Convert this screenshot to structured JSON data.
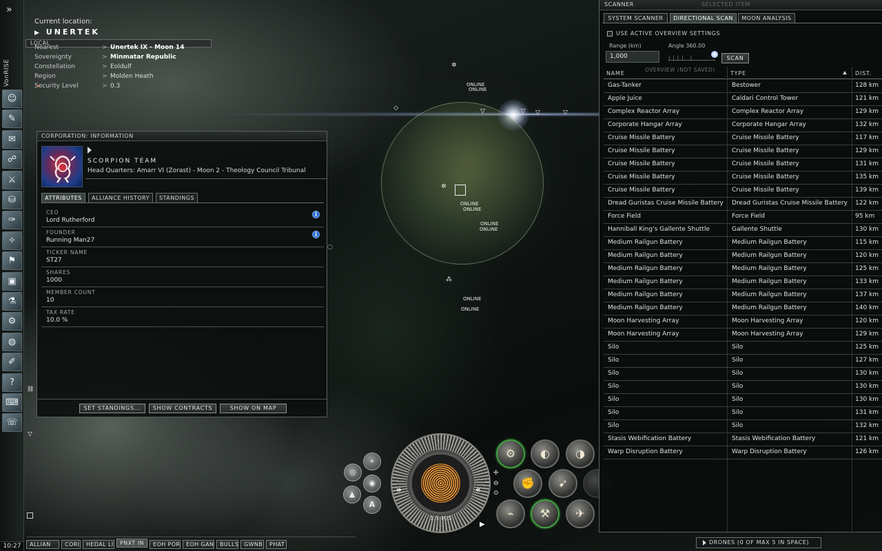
{
  "neocom": {
    "username": "VonRISE",
    "clock": "10:27",
    "buttons": [
      "character-sheet-icon",
      "skills-icon",
      "mail-icon",
      "people-places-icon",
      "wallet-icon",
      "market-icon",
      "journal-icon",
      "map-icon",
      "corporation-icon",
      "assets-icon",
      "science-industry-icon",
      "fitting-icon",
      "browser-icon",
      "notepad-icon",
      "help-icon",
      "calculator-icon",
      "support-icon"
    ]
  },
  "location": {
    "current_label": "Current location:",
    "system": "UNERTEK",
    "local_tab": "LOCAL",
    "rows": [
      {
        "key": "Nearest",
        "value": "Unertek IX - Moon 14"
      },
      {
        "key": "Sovereignty",
        "value": "Minmatar Republic"
      },
      {
        "key": "Constellation",
        "value": "Eoldulf"
      },
      {
        "key": "Region",
        "value": "Molden Heath"
      },
      {
        "key": "Security Level",
        "value": "0.3"
      }
    ]
  },
  "corp_window": {
    "caption": "CORPORATION: INFORMATION",
    "corp_name": "SCORPION TEAM",
    "headquarters": "Head Quarters: Amarr VI (Zorast) - Moon 2 - Theology Council Tribunal",
    "tabs": [
      "ATTRIBUTES",
      "ALLIANCE HISTORY",
      "STANDINGS"
    ],
    "attributes": [
      {
        "label": "CEO",
        "value": "Lord Rutherford"
      },
      {
        "label": "FOUNDER",
        "value": "Running Man27"
      },
      {
        "label": "TICKER NAME",
        "value": "ST27"
      },
      {
        "label": "SHARES",
        "value": "1000"
      },
      {
        "label": "MEMBER COUNT",
        "value": "10"
      },
      {
        "label": "TAX RATE",
        "value": "10.0 %"
      }
    ],
    "buttons": [
      "SET STANDINGS...",
      "SHOW CONTRACTS",
      "SHOW ON MAP"
    ]
  },
  "space": {
    "labels": [
      "ONLINE",
      "ONLINE",
      "ONLINE",
      "ONLINE",
      "ONLINE",
      "ONLINE",
      "ONLINE",
      "ONLINE"
    ]
  },
  "hud": {
    "speed": "1.5 M/S"
  },
  "scanner": {
    "caption": "SCANNER",
    "selected_item": "SELECTED ITEM",
    "tabs": [
      "SYSTEM SCANNER",
      "DIRECTIONAL SCAN",
      "MOON ANALYSIS"
    ],
    "use_active_overview": "USE ACTIVE OVERVIEW SETTINGS",
    "range_label": "Range (km)",
    "range_value": "1,000",
    "angle_label": "Angle 360.00",
    "scan_button": "SCAN",
    "overview_note": "OVERVIEW (NOT SAVED)",
    "columns": [
      "NAME",
      "TYPE",
      "DIST."
    ],
    "rows": [
      [
        "Gas-Tanker",
        "Bestower",
        "128 km"
      ],
      [
        "Apple Juice",
        "Caldari Control Tower",
        "121 km"
      ],
      [
        "Complex Reactor Array",
        "Complex Reactor Array",
        "129 km"
      ],
      [
        "Corporate Hangar Array",
        "Corporate Hangar Array",
        "132 km"
      ],
      [
        "Cruise Missile Battery",
        "Cruise Missile Battery",
        "117 km"
      ],
      [
        "Cruise Missile Battery",
        "Cruise Missile Battery",
        "129 km"
      ],
      [
        "Cruise Missile Battery",
        "Cruise Missile Battery",
        "131 km"
      ],
      [
        "Cruise Missile Battery",
        "Cruise Missile Battery",
        "135 km"
      ],
      [
        "Cruise Missile Battery",
        "Cruise Missile Battery",
        "139 km"
      ],
      [
        "Dread Guristas Cruise Missile Battery",
        "Dread Guristas Cruise Missile Battery",
        "122 km"
      ],
      [
        "Force Field",
        "Force Field",
        "95 km"
      ],
      [
        "Hanniball King's Gallente Shuttle",
        "Gallente Shuttle",
        "130 km"
      ],
      [
        "Medium Railgun Battery",
        "Medium Railgun Battery",
        "115 km"
      ],
      [
        "Medium Railgun Battery",
        "Medium Railgun Battery",
        "120 km"
      ],
      [
        "Medium Railgun Battery",
        "Medium Railgun Battery",
        "125 km"
      ],
      [
        "Medium Railgun Battery",
        "Medium Railgun Battery",
        "133 km"
      ],
      [
        "Medium Railgun Battery",
        "Medium Railgun Battery",
        "137 km"
      ],
      [
        "Medium Railgun Battery",
        "Medium Railgun Battery",
        "140 km"
      ],
      [
        "Moon Harvesting Array",
        "Moon Harvesting Array",
        "120 km"
      ],
      [
        "Moon Harvesting Array",
        "Moon Harvesting Array",
        "129 km"
      ],
      [
        "Silo",
        "Silo",
        "125 km"
      ],
      [
        "Silo",
        "Silo",
        "127 km"
      ],
      [
        "Silo",
        "Silo",
        "130 km"
      ],
      [
        "Silo",
        "Silo",
        "130 km"
      ],
      [
        "Silo",
        "Silo",
        "130 km"
      ],
      [
        "Silo",
        "Silo",
        "131 km"
      ],
      [
        "Silo",
        "Silo",
        "132 km"
      ],
      [
        "Stasis Webification Battery",
        "Stasis Webification Battery",
        "121 km"
      ],
      [
        "Warp Disruption Battery",
        "Warp Disruption Battery",
        "126 km"
      ]
    ]
  },
  "drones": "DRONES (0 OF MAX 5 IN SPACE)",
  "taskbar": [
    "ALLIAN",
    "CORI",
    "HEDAL LI",
    "PNXT IN",
    "EOH POR",
    "EOH GAN",
    "BULLS",
    "GWNB!",
    "PHAT"
  ]
}
